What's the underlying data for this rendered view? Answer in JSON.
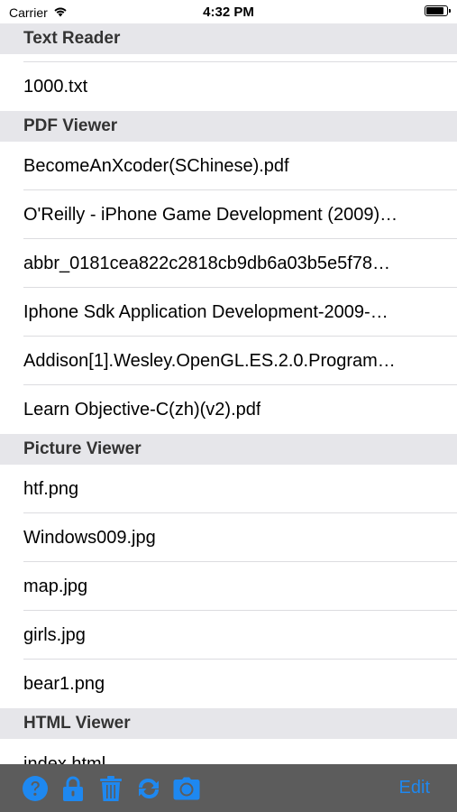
{
  "status_bar": {
    "carrier": "Carrier",
    "time": "4:32 PM"
  },
  "sections": [
    {
      "title": "Text Reader",
      "items": [
        "1000.txt"
      ]
    },
    {
      "title": "PDF Viewer",
      "items": [
        "BecomeAnXcoder(SChinese).pdf",
        "O'Reilly - iPhone Game Development (2009)…",
        "abbr_0181cea822c2818cb9db6a03b5e5f78…",
        "Iphone Sdk Application Development-2009-…",
        "Addison[1].Wesley.OpenGL.ES.2.0.Program…",
        "Learn Objective-C(zh)(v2).pdf"
      ]
    },
    {
      "title": "Picture Viewer",
      "items": [
        "htf.png",
        "Windows009.jpg",
        "map.jpg",
        "girls.jpg",
        "bear1.png"
      ]
    },
    {
      "title": "HTML Viewer",
      "items": [
        "index.html"
      ]
    }
  ],
  "toolbar": {
    "icons": [
      "help-icon",
      "lock-icon",
      "trash-icon",
      "refresh-icon",
      "camera-icon"
    ],
    "edit_label": "Edit",
    "accent_color": "#1e88f0",
    "background_color": "#5c5c5c"
  }
}
